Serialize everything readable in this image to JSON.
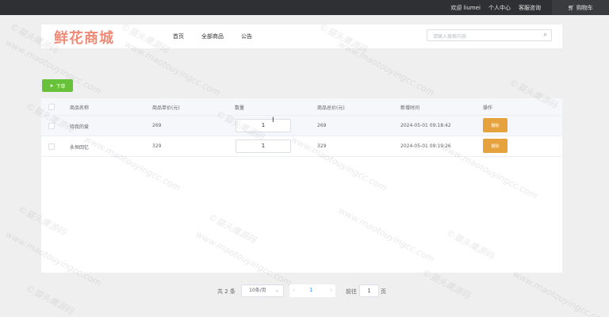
{
  "topbar": {
    "welcome": "欢迎 liumei",
    "user_center": "个人中心",
    "service": "客服咨询",
    "cart_icon": "cart-icon",
    "cart": "购物车"
  },
  "header": {
    "logo": "鲜花商城",
    "nav": [
      "首页",
      "全部商品",
      "公告"
    ],
    "search_placeholder": "请输入搜索内容",
    "search_icon": "search-icon"
  },
  "toolbar": {
    "order_label": "下单",
    "order_icon": "send-icon"
  },
  "table": {
    "columns": [
      "商品名称",
      "商品单价(元)",
      "数量",
      "商品总价(元)",
      "新增时间",
      "操作"
    ],
    "rows": [
      {
        "name": "待我的爱",
        "price": "269",
        "qty": "1",
        "total": "269",
        "time": "2024-05-01 09:18:42",
        "action": "删除"
      },
      {
        "name": "永恒回忆",
        "price": "329",
        "qty": "1",
        "total": "329",
        "time": "2024-05-01 09:19:26",
        "action": "删除"
      }
    ]
  },
  "pagination": {
    "total": "共 2 条",
    "page_size": "10条/页",
    "prev": "‹",
    "current": "1",
    "next": "›",
    "goto_label": "前往",
    "goto_value": "1",
    "page_suffix": "页"
  },
  "watermark": {
    "text1": "©猫头鹰源码",
    "text2": "www.maotouyingcc.com"
  },
  "colors": {
    "topbar": "#2f3033",
    "logo": "#f08b78",
    "order_button": "#67c23a",
    "delete_button": "#e6a23c",
    "link": "#409eff"
  }
}
